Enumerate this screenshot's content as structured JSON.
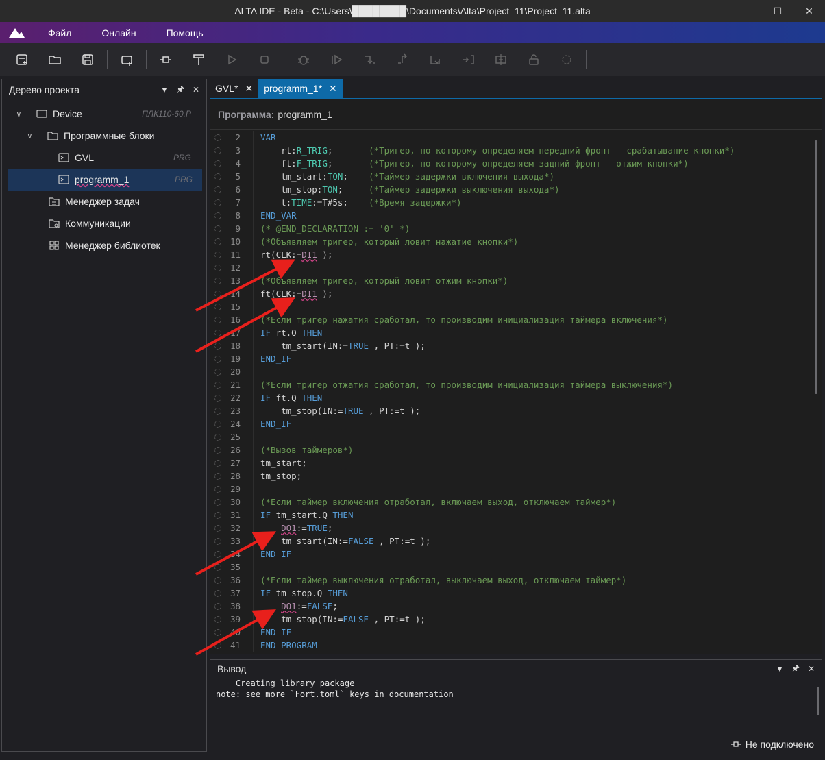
{
  "window": {
    "title": "ALTA IDE - Beta - C:\\Users\\████████\\Documents\\Alta\\Project_11\\Project_11.alta"
  },
  "menu": {
    "items": [
      "Файл",
      "Онлайн",
      "Помощь"
    ]
  },
  "project_tree": {
    "title": "Дерево проекта",
    "device": {
      "label": "Device",
      "suffix": "ПЛК110-60.Р"
    },
    "program_blocks": {
      "label": "Программные блоки"
    },
    "gvl": {
      "label": "GVL",
      "suffix": "PRG"
    },
    "programm_1": {
      "label": "programm_1",
      "suffix": "PRG"
    },
    "task_manager": {
      "label": "Менеджер задач"
    },
    "communications": {
      "label": "Коммуникации"
    },
    "library_manager": {
      "label": "Менеджер библиотек"
    }
  },
  "tabs": [
    {
      "label": "GVL*"
    },
    {
      "label": "programm_1*"
    }
  ],
  "editor": {
    "header_label": "Программа:",
    "header_value": "programm_1"
  },
  "code_lines": [
    {
      "n": "2",
      "t": "VAR"
    },
    {
      "n": "3",
      "t": "    rt:R_TRIG;       (*Тригер, по которому определяем передний фронт - срабатывание кнопки*)"
    },
    {
      "n": "4",
      "t": "    ft:F_TRIG;       (*Тригер, по которому определяем задний фронт - отжим кнопки*)"
    },
    {
      "n": "5",
      "t": "    tm_start:TON;    (*Таймер задержки включения выхода*)"
    },
    {
      "n": "6",
      "t": "    tm_stop:TON;     (*Таймер задержки выключения выхода*)"
    },
    {
      "n": "7",
      "t": "    t:TIME:=T#5s;    (*Время задержки*)"
    },
    {
      "n": "8",
      "t": "END_VAR"
    },
    {
      "n": "9",
      "t": "(* @END_DECLARATION := '0' *)"
    },
    {
      "n": "10",
      "t": "(*Объявляем тригер, который ловит нажатие кнопки*)"
    },
    {
      "n": "11",
      "t": "rt(CLK:=DI1 );"
    },
    {
      "n": "12",
      "t": ""
    },
    {
      "n": "13",
      "t": "(*Объявляем тригер, который ловит отжим кнопки*)"
    },
    {
      "n": "14",
      "t": "ft(CLK:=DI1 );"
    },
    {
      "n": "15",
      "t": ""
    },
    {
      "n": "16",
      "t": "(*Если тригер нажатия сработал, то производим инициализация таймера включения*)"
    },
    {
      "n": "17",
      "t": "IF rt.Q THEN"
    },
    {
      "n": "18",
      "t": "    tm_start(IN:=TRUE , PT:=t );"
    },
    {
      "n": "19",
      "t": "END_IF"
    },
    {
      "n": "20",
      "t": ""
    },
    {
      "n": "21",
      "t": "(*Если тригер отжатия сработал, то производим инициализация таймера выключения*)"
    },
    {
      "n": "22",
      "t": "IF ft.Q THEN"
    },
    {
      "n": "23",
      "t": "    tm_stop(IN:=TRUE , PT:=t );"
    },
    {
      "n": "24",
      "t": "END_IF"
    },
    {
      "n": "25",
      "t": ""
    },
    {
      "n": "26",
      "t": "(*Вызов таймеров*)"
    },
    {
      "n": "27",
      "t": "tm_start;"
    },
    {
      "n": "28",
      "t": "tm_stop;"
    },
    {
      "n": "29",
      "t": ""
    },
    {
      "n": "30",
      "t": "(*Если таймер включения отработал, включаем выход, отключаем таймер*)"
    },
    {
      "n": "31",
      "t": "IF tm_start.Q THEN"
    },
    {
      "n": "32",
      "t": "    DO1:=TRUE;"
    },
    {
      "n": "33",
      "t": "    tm_start(IN:=FALSE , PT:=t );"
    },
    {
      "n": "34",
      "t": "END_IF"
    },
    {
      "n": "35",
      "t": ""
    },
    {
      "n": "36",
      "t": "(*Если таймер выключения отработал, выключаем выход, отключаем таймер*)"
    },
    {
      "n": "37",
      "t": "IF tm_stop.Q THEN"
    },
    {
      "n": "38",
      "t": "    DO1:=FALSE;"
    },
    {
      "n": "39",
      "t": "    tm_stop(IN:=FALSE , PT:=t );"
    },
    {
      "n": "40",
      "t": "END_IF"
    },
    {
      "n": "41",
      "t": "END_PROGRAM"
    }
  ],
  "output": {
    "title": "Вывод",
    "lines": [
      "    Creating library package",
      "note: see more `Fort.toml` keys in documentation"
    ]
  },
  "status": {
    "connection": "Не подключено"
  },
  "colors": {
    "accent": "#0e6aa8",
    "arrow": "#e8201c",
    "comment": "#6a9955",
    "keyword": "#569cd6"
  }
}
